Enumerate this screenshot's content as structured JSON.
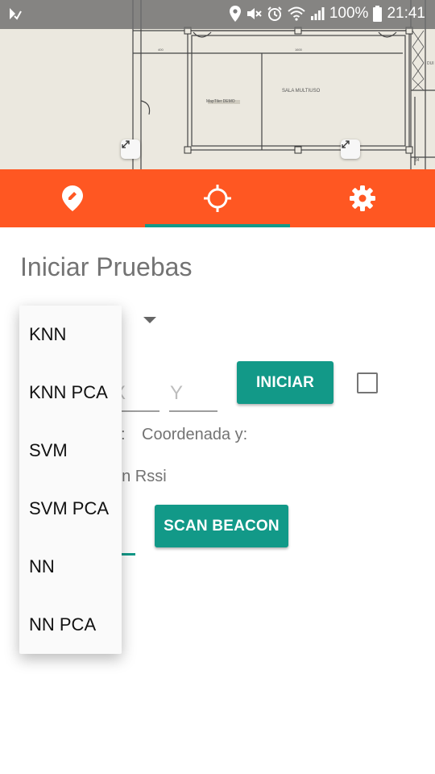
{
  "status_bar": {
    "battery": "100%",
    "time": "21:41",
    "icons": [
      "notification-check-icon",
      "location-icon",
      "mute-icon",
      "alarm-icon",
      "wifi-icon",
      "signal-icon",
      "battery-icon"
    ]
  },
  "map": {
    "labels": {
      "sala": "SALA MULTIUSO",
      "demo": "MapTiler DEMO",
      "dim1": "400",
      "dim2": "1600",
      "dim3": "34",
      "dim4": "DUI"
    }
  },
  "tabs": [
    {
      "icon": "location-edit-icon",
      "selected": false
    },
    {
      "icon": "crosshair-icon",
      "selected": true
    },
    {
      "icon": "settings-gear-icon",
      "selected": false
    }
  ],
  "colors": {
    "accent": "#ff5722",
    "primary": "#129988"
  },
  "main": {
    "title": "Iniciar Pruebas",
    "x_placeholder": "X",
    "y_placeholder": "Y",
    "start_button": "INICIAR",
    "coord_x_label_fragment": "x:",
    "coord_y_label": "Coordenada y:",
    "rssi_label_fragment": "on Rssi",
    "scan_button": "SCAN BEACON"
  },
  "dropdown": {
    "options": [
      "KNN",
      "KNN PCA",
      "SVM",
      "SVM PCA",
      "NN",
      "NN PCA"
    ]
  }
}
